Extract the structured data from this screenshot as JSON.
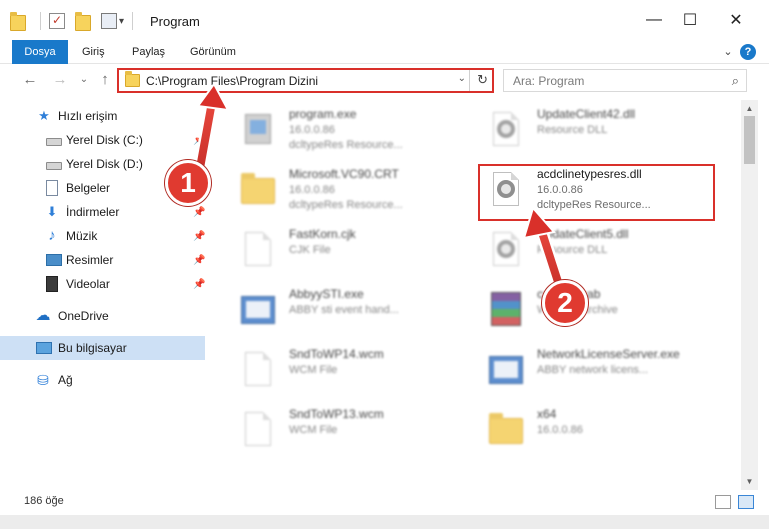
{
  "window": {
    "title": "Program",
    "minimize_glyph": "—",
    "maximize_glyph": "☐",
    "close_glyph": "✕",
    "qa_dropdown_glyph": "▾",
    "qa_check_glyph": "✓"
  },
  "ribbon": {
    "tabs": [
      "Dosya",
      "Giriş",
      "Paylaş",
      "Görünüm"
    ],
    "expand_glyph": "⌄",
    "help_glyph": "?"
  },
  "nav": {
    "back_glyph": "←",
    "forward_glyph": "→",
    "recent_glyph": "⌄",
    "up_glyph": "↑",
    "address": "C:\\Program Files\\Program Dizini",
    "address_dropdown_glyph": "⌄",
    "refresh_glyph": "↻",
    "search_placeholder": "Ara: Program",
    "search_glyph": "⌕"
  },
  "sidebar": {
    "items": [
      {
        "label": "Hızlı erişim",
        "icon": "star-icon",
        "glyph": "★"
      },
      {
        "label": "Yerel Disk (C:)",
        "icon": "drive-icon",
        "glyph": ""
      },
      {
        "label": "Yerel Disk (D:)",
        "icon": "drive-icon",
        "glyph": ""
      },
      {
        "label": "Belgeler",
        "icon": "document-icon",
        "glyph": ""
      },
      {
        "label": "İndirmeler",
        "icon": "download-icon",
        "glyph": "⬇"
      },
      {
        "label": "Müzik",
        "icon": "music-icon",
        "glyph": "♪"
      },
      {
        "label": "Resimler",
        "icon": "picture-icon",
        "glyph": ""
      },
      {
        "label": "Videolar",
        "icon": "video-icon",
        "glyph": ""
      },
      {
        "label": "OneDrive",
        "icon": "cloud-icon",
        "glyph": "☁"
      },
      {
        "label": "Bu bilgisayar",
        "icon": "computer-icon",
        "glyph": ""
      },
      {
        "label": "Ağ",
        "icon": "network-icon",
        "glyph": "⛁"
      }
    ],
    "pin_glyph": "📌"
  },
  "files": [
    {
      "name": "program.exe",
      "line1": "16.0.0.86",
      "line2": "dcltypeRes Resource...",
      "icon": "exe-icon"
    },
    {
      "name": "UpdateClient42.dll",
      "line1": "Resource DLL",
      "line2": "",
      "icon": "dll-gear-icon"
    },
    {
      "name": "Microsoft.VC90.CRT",
      "line1": "16.0.0.86",
      "line2": "dcltypeRes Resource...",
      "icon": "folder-icon"
    },
    {
      "name": "acdclinetypesres.dll",
      "line1": "16.0.0.86",
      "line2": "dcltypeRes Resource...",
      "icon": "dll-gear-icon"
    },
    {
      "name": "FastKorn.cjk",
      "line1": "CJK File",
      "line2": "",
      "icon": "file-icon"
    },
    {
      "name": "UpdateClient5.dll",
      "line1": "Resource DLL",
      "line2": "",
      "icon": "dll-gear-icon"
    },
    {
      "name": "AbbyySTI.exe",
      "line1": "ABBY sti event hand...",
      "line2": "",
      "icon": "app-icon"
    },
    {
      "name": "cabfiles.cab",
      "line1": "WinRAR archive",
      "line2": "",
      "icon": "archive-icon"
    },
    {
      "name": "SndToWP14.wcm",
      "line1": "WCM File",
      "line2": "",
      "icon": "file-icon"
    },
    {
      "name": "NetworkLicenseServer.exe",
      "line1": "ABBY network licens...",
      "line2": "",
      "icon": "app-icon"
    },
    {
      "name": "SndToWP13.wcm",
      "line1": "WCM File",
      "line2": "",
      "icon": "file-icon"
    },
    {
      "name": "x64",
      "line1": "16.0.0.86",
      "line2": "",
      "icon": "folder-icon"
    }
  ],
  "scrollbar": {
    "up_glyph": "▲",
    "down_glyph": "▼"
  },
  "status": {
    "item_count": "186 öğe"
  },
  "annotations": [
    {
      "number": "1"
    },
    {
      "number": "2"
    }
  ],
  "colors": {
    "accent": "#1979ca",
    "highlight_red": "#d9302a",
    "selected_bg": "#cde0f5"
  }
}
